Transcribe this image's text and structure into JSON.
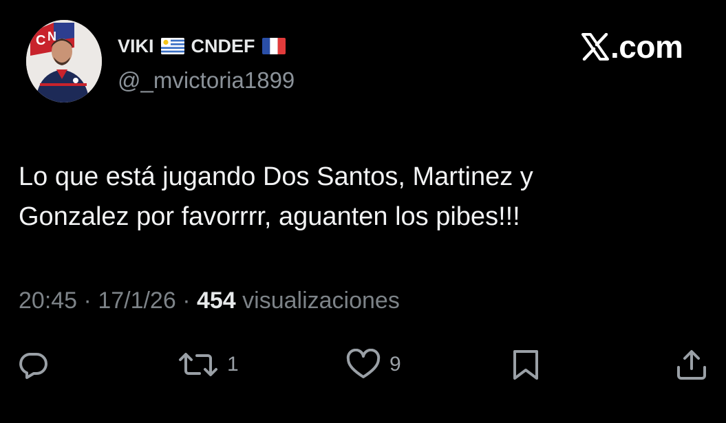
{
  "site": {
    "logo_text": ".com",
    "logo_icon": "x-logo-icon"
  },
  "author": {
    "name_part1": "VIKI",
    "flag1": "uruguay-flag",
    "name_part2": "CNDEF",
    "flag2": "france-flag",
    "handle": "@_mvictoria1899",
    "avatar_icon": "profile-photo"
  },
  "tweet": {
    "line1": "Lo que está jugando Dos Santos, Martinez y",
    "line2": "Gonzalez por favorrrr, aguanten los pibes!!!"
  },
  "meta": {
    "time": "20:45",
    "separator1": " · ",
    "date": "17/1/26",
    "separator2": " · ",
    "views_count": "454",
    "views_label": " visualizaciones"
  },
  "actions": {
    "reply_icon": "reply-icon",
    "retweet_icon": "retweet-icon",
    "retweet_count": "1",
    "like_icon": "heart-icon",
    "like_count": "9",
    "bookmark_icon": "bookmark-icon",
    "share_icon": "share-icon"
  },
  "colors": {
    "background": "#000000",
    "text_primary": "#e7e9ea",
    "text_secondary": "#7d8388",
    "icon": "#9aa0a6"
  }
}
